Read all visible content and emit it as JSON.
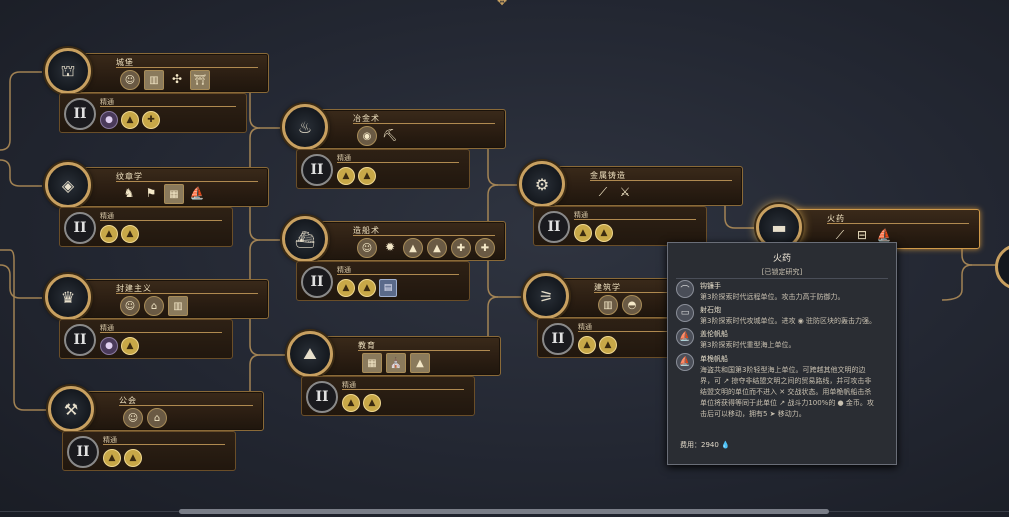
{
  "columns": [
    {
      "nodes": [
        {
          "id": "n-castle",
          "title": "城堡",
          "emblem": "castle-icon",
          "glyph": "⛫",
          "unlocks": [
            {
              "name": "soldier-unit-icon",
              "glyph": "☺"
            },
            {
              "name": "building-icon",
              "glyph": "▥",
              "sq": true
            },
            {
              "name": "crossbow-icon",
              "glyph": "✣",
              "pl": true
            },
            {
              "name": "gate-icon",
              "glyph": "⛩",
              "sq": true
            }
          ],
          "mastery": {
            "title": "精通",
            "icons": [
              {
                "name": "gem-icon",
                "glyph": "●",
                "d": true
              },
              {
                "name": "gold-coin-icon",
                "glyph": "▲"
              },
              {
                "name": "plus-icon",
                "glyph": "✚"
              }
            ]
          }
        },
        {
          "id": "n-heraldry",
          "title": "纹章学",
          "emblem": "heraldry-icon",
          "glyph": "◈",
          "unlocks": [
            {
              "name": "knight-icon",
              "glyph": "♞",
              "pl": true
            },
            {
              "name": "flag-icon",
              "glyph": "⚑",
              "pl": true
            },
            {
              "name": "map-icon",
              "glyph": "▦",
              "sq": true
            },
            {
              "name": "ship-icon",
              "glyph": "⛵",
              "pl": true
            }
          ],
          "mastery": {
            "title": "精通",
            "icons": [
              {
                "name": "gold-coin-icon",
                "glyph": "▲"
              },
              {
                "name": "gold-coin-icon",
                "glyph": "▲"
              }
            ]
          }
        },
        {
          "id": "n-feudalism",
          "title": "封建主义",
          "emblem": "feudalism-icon",
          "glyph": "♛",
          "unlocks": [
            {
              "name": "soldier-unit-icon",
              "glyph": "☺"
            },
            {
              "name": "house-icon",
              "glyph": "⌂"
            },
            {
              "name": "building-icon",
              "glyph": "▥",
              "sq": true
            }
          ],
          "mastery": {
            "title": "精通",
            "icons": [
              {
                "name": "unit-icon",
                "glyph": "●",
                "d": true
              },
              {
                "name": "gold-coin-icon",
                "glyph": "▲"
              }
            ]
          }
        },
        {
          "id": "n-guild",
          "title": "公会",
          "emblem": "guild-icon",
          "glyph": "⚒",
          "unlocks": [
            {
              "name": "worker-icon",
              "glyph": "☺"
            },
            {
              "name": "tent-icon",
              "glyph": "⌂"
            }
          ],
          "mastery": {
            "title": "精通",
            "icons": [
              {
                "name": "gold-coin-icon",
                "glyph": "▲"
              },
              {
                "name": "gold-coin-icon",
                "glyph": "▲"
              }
            ]
          }
        }
      ]
    },
    {
      "nodes": [
        {
          "id": "n-metallurgy",
          "title": "冶金术",
          "emblem": "metallurgy-icon",
          "glyph": "♨",
          "unlocks": [
            {
              "name": "shield-icon",
              "glyph": "◉"
            },
            {
              "name": "catapult-icon",
              "glyph": "⛏",
              "pl": true
            }
          ],
          "mastery": {
            "title": "精通",
            "icons": [
              {
                "name": "gold-coin-icon",
                "glyph": "▲"
              },
              {
                "name": "gold-coin-icon",
                "glyph": "▲"
              }
            ]
          }
        },
        {
          "id": "n-shipbuilding",
          "title": "造船术",
          "emblem": "shipbuilding-icon",
          "glyph": "⛴",
          "unlocks": [
            {
              "name": "unit-icon",
              "glyph": "☺"
            },
            {
              "name": "bomb-icon",
              "glyph": "✹",
              "pl": true
            },
            {
              "name": "gold-coin-icon",
              "glyph": "▲"
            },
            {
              "name": "gold-coin-icon",
              "glyph": "▲"
            },
            {
              "name": "plus-icon",
              "glyph": "✚"
            },
            {
              "name": "plus-icon",
              "glyph": "✚"
            }
          ],
          "mastery": {
            "title": "精通",
            "icons": [
              {
                "name": "gold-coin-icon",
                "glyph": "▲"
              },
              {
                "name": "gold-coin-icon",
                "glyph": "▲"
              },
              {
                "name": "book-icon",
                "glyph": "▤",
                "bl": true
              }
            ]
          }
        },
        {
          "id": "n-education",
          "title": "教育",
          "emblem": "education-icon",
          "glyph": "⛰",
          "unlocks": [
            {
              "name": "map-icon",
              "glyph": "▦",
              "sq": true
            },
            {
              "name": "tower-icon",
              "glyph": "⛪",
              "sq": true
            },
            {
              "name": "gold-coin-icon",
              "glyph": "▲",
              "sq": true
            }
          ],
          "mastery": {
            "title": "精通",
            "icons": [
              {
                "name": "gold-coin-icon",
                "glyph": "▲"
              },
              {
                "name": "gold-coin-icon",
                "glyph": "▲"
              }
            ]
          }
        }
      ]
    },
    {
      "nodes": [
        {
          "id": "n-metalcasting",
          "title": "金属铸造",
          "emblem": "metalcasting-icon",
          "glyph": "⚙",
          "unlocks": [
            {
              "name": "musket-icon",
              "glyph": "⟋",
              "pl": true
            },
            {
              "name": "crossed-weapon-icon",
              "glyph": "⚔",
              "pl": true
            }
          ],
          "mastery": {
            "title": "精通",
            "icons": [
              {
                "name": "gold-coin-icon",
                "glyph": "▲"
              },
              {
                "name": "gold-coin-icon",
                "glyph": "▲"
              }
            ]
          }
        },
        {
          "id": "n-architecture",
          "title": "建筑学",
          "emblem": "architecture-icon",
          "glyph": "⚞",
          "unlocks": [
            {
              "name": "building-icon",
              "glyph": "▥"
            },
            {
              "name": "dome-icon",
              "glyph": "◓"
            }
          ],
          "mastery": {
            "title": "精通",
            "icons": [
              {
                "name": "gold-coin-icon",
                "glyph": "▲"
              },
              {
                "name": "gold-coin-icon",
                "glyph": "▲"
              }
            ]
          }
        }
      ]
    },
    {
      "nodes": [
        {
          "id": "n-gunpowder",
          "title": "火药",
          "emblem": "gunpowder-icon",
          "glyph": "▬",
          "highlighted": true,
          "unlocks": [
            {
              "name": "musket-icon",
              "glyph": "⟋",
              "pl": true
            },
            {
              "name": "cannon-icon",
              "glyph": "⊟",
              "pl": true
            },
            {
              "name": "ship-icon",
              "glyph": "⛵",
              "pl": true
            }
          ]
        }
      ]
    }
  ],
  "tooltip": {
    "title": "火药",
    "subtitle": "[已锁定研究]",
    "entries": [
      {
        "icon": "hook-icon",
        "glyph": "⌒",
        "name": "钩镰手",
        "desc": [
          "第3阶探索时代远程单位。攻击力高于防御力。"
        ]
      },
      {
        "icon": "trebuchet-icon",
        "glyph": "▭",
        "name": "射石炮",
        "desc": [
          "第3阶探索时代攻城单位。进攻 ◉ 驻防区块的轰击力强。"
        ]
      },
      {
        "icon": "galleon-icon",
        "glyph": "⛵",
        "name": "盖伦帆船",
        "desc": [
          "第3阶探索时代重型海上单位。"
        ]
      },
      {
        "icon": "cog-ship-icon",
        "glyph": "⛵",
        "name": "单桅帆船",
        "desc": [
          "海盗共和国第3阶轻型海上单位。可跨越其他文明的边",
          "界，可 ↗ 掠夺非结盟文明之间的贸易路线，并可攻击非",
          "结盟文明的单位而不进入 ✕ 交战状态。用单桅帆船击杀",
          "单位将获得等同于此单位 ↗ 战斗力100%的 ● 金币。攻",
          "击后可以移动，拥有5 ➤ 移动力。"
        ]
      }
    ],
    "cost_label": "费用：",
    "cost_value": "2940",
    "cost_icon": "science-icon"
  },
  "colors": {
    "accent": "#c8a060",
    "panel": "#2a1d12",
    "tooltip_bg": "#2a2d33"
  }
}
